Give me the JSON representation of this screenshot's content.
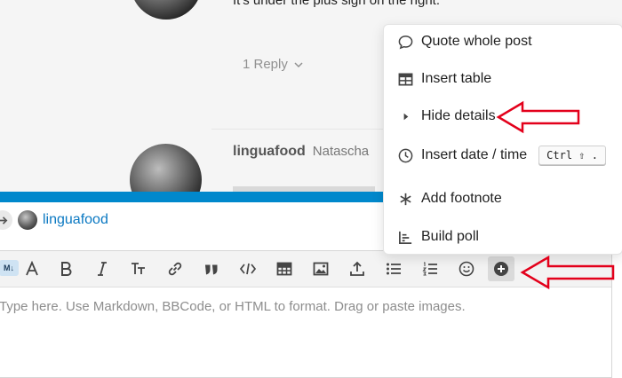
{
  "topic": {
    "post_text": "It's under the plus sign on the right.",
    "replies_label": "1 Reply",
    "poster_username": "linguafood",
    "poster_name": "Natascha"
  },
  "composer": {
    "reply_to_user": "linguafood",
    "placeholder": "Type here. Use Markdown, BBCode, or HTML to format. Drag or paste images.",
    "toolbar": {
      "markdown_toggle": "M↓",
      "buttons": [
        "toggle-rich-editor",
        "bold",
        "italic",
        "heading",
        "link",
        "quote",
        "code",
        "table",
        "image",
        "upload",
        "bullet-list",
        "numbered-list",
        "emoji",
        "more-options"
      ]
    },
    "accent_color": "#0088cc"
  },
  "options_menu": {
    "items": [
      {
        "label": "Quote whole post",
        "icon": "comment-icon"
      },
      {
        "label": "Insert table",
        "icon": "table-icon"
      },
      {
        "label": "Hide details",
        "icon": "caret-right-icon"
      },
      {
        "label": "Insert date / time",
        "icon": "clock-icon",
        "shortcut": "Ctrl ⇧ ."
      },
      {
        "label": "Add footnote",
        "icon": "asterisk-icon"
      },
      {
        "label": "Build poll",
        "icon": "chart-icon"
      }
    ]
  },
  "annotation_color": "#e3001b"
}
